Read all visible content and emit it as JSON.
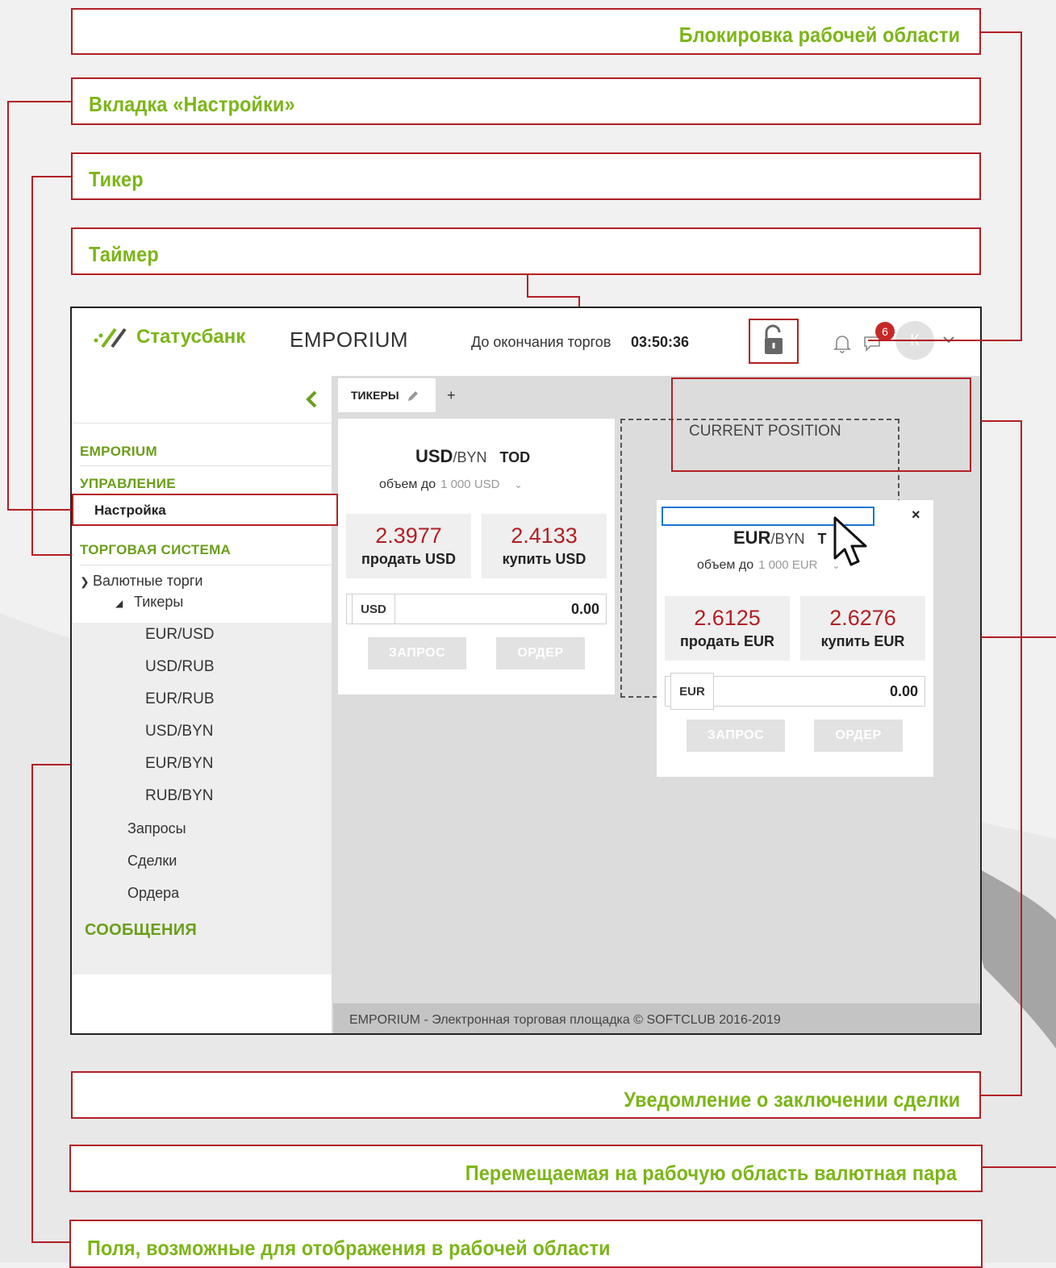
{
  "callouts": {
    "lock": "Блокировка рабочей области",
    "settings_tab": "Вкладка «Настройки»",
    "ticker": "Тикер",
    "timer": "Таймер",
    "deal_notice": "Уведомление о заключении сделки",
    "movable_pair": "Перемещаемая на рабочую область валютная пара",
    "fields": "Поля, возможные для отображения в рабочей области"
  },
  "header": {
    "logo": "Статусбанк",
    "app_name": "EMPORIUM",
    "timer_label": "До окончания торгов",
    "timer_value": "03:50:36",
    "notifications_count": "6",
    "avatar_initial": "К"
  },
  "sidebar": {
    "section_emporium": "EMPORIUM",
    "section_management": "УПРАВЛЕНИЕ",
    "settings_item": "Настройка",
    "section_trading": "ТОРГОВАЯ СИСТЕМА",
    "currency_trading": "Валютные торги",
    "tickers": "Тикеры",
    "ticker_items": [
      "EUR/USD",
      "USD/RUB",
      "EUR/RUB",
      "USD/BYN",
      "EUR/BYN",
      "RUB/BYN"
    ],
    "requests": "Запросы",
    "deals": "Сделки",
    "orders": "Ордера",
    "messages": "СООБЩЕНИЯ"
  },
  "tabs": {
    "tickers_tab": "ТИКЕРЫ",
    "add": "+"
  },
  "usd_card": {
    "base": "USD",
    "quote": "/BYN",
    "term": "TOD",
    "volume_label": "объем до",
    "volume_value": "1 000 USD",
    "sell_price": "2.3977",
    "sell_label": "продать USD",
    "buy_price": "2.4133",
    "buy_label": "купить USD",
    "currency": "USD",
    "amount": "0.00",
    "request_btn": "ЗАПРОС",
    "order_btn": "ОРДЕР"
  },
  "eur_card": {
    "base": "EUR",
    "quote": "/BYN",
    "term": "T",
    "volume_label": "объем до",
    "volume_value": "1 000 EUR",
    "sell_price": "2.6125",
    "sell_label": "продать EUR",
    "buy_price": "2.6276",
    "buy_label": "купить EUR",
    "currency": "EUR",
    "amount": "0.00",
    "request_btn": "ЗАПРОС",
    "order_btn": "ОРДЕР",
    "close": "×"
  },
  "current_position": "CURRENT POSITION",
  "footer": "EMPORIUM - Электронная торговая площадка © SOFTCLUB 2016-2019",
  "colors": {
    "accent_green": "#7cb518",
    "frame_red": "#b21f24",
    "price_red": "#b21f24",
    "drag_blue": "#1976d2"
  }
}
